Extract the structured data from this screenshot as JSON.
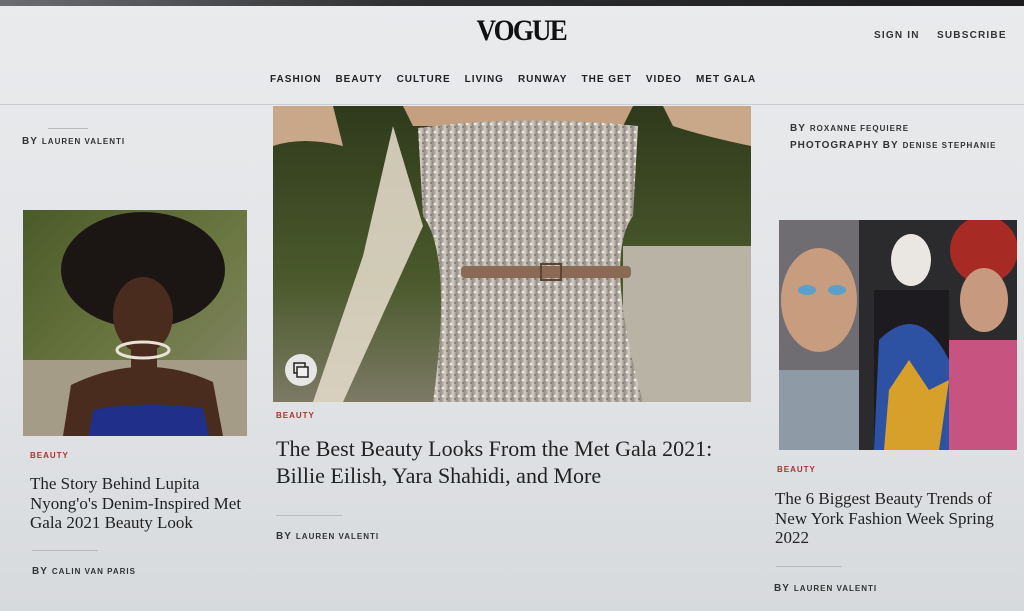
{
  "header": {
    "logo": "VOGUE",
    "sign_in": "SIGN IN",
    "subscribe": "SUBSCRIBE"
  },
  "nav": [
    "FASHION",
    "BEAUTY",
    "CULTURE",
    "LIVING",
    "RUNWAY",
    "THE GET",
    "VIDEO",
    "MET GALA"
  ],
  "left": {
    "top_byline_by": "BY",
    "top_byline_name": "LAUREN VALENTI",
    "kicker": "BEAUTY",
    "headline": "The Story Behind Lupita Nyong'o's Denim-Inspired Met Gala 2021 Beauty Look",
    "byline_by": "BY",
    "byline_name": "CALIN VAN PARIS"
  },
  "center": {
    "kicker": "BEAUTY",
    "headline": "The Best Beauty Looks From the Met Gala 2021: Billie Eilish, Yara Shahidi, and More",
    "byline_by": "BY",
    "byline_name": "LAUREN VALENTI"
  },
  "right": {
    "top_by": "BY",
    "top_name": "ROXANNE FEQUIERE",
    "photo_by": "PHOTOGRAPHY BY",
    "photo_name": "DENISE STEPHANIE",
    "kicker": "BEAUTY",
    "headline": "The 6 Biggest Beauty Trends of New York Fashion Week Spring 2022",
    "byline_by": "BY",
    "byline_name": "LAUREN VALENTI"
  },
  "colors": {
    "kicker": "#a5382d",
    "text": "#222222"
  },
  "icons": {
    "gallery": "gallery-icon"
  }
}
